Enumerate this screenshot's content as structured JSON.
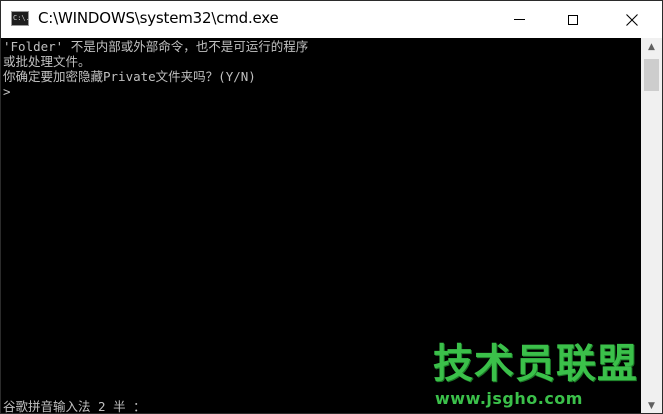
{
  "window": {
    "title": "C:\\WINDOWS\\system32\\cmd.exe",
    "icon": "cmd-console-icon",
    "icon_text": "C:\\."
  },
  "caption_buttons": {
    "minimize_icon": "minimize-icon",
    "maximize_icon": "maximize-icon",
    "close_icon": "close-icon"
  },
  "console": {
    "lines": [
      "'Folder' 不是内部或外部命令，也不是可运行的程序",
      "或批处理文件。",
      "你确定要加密隐藏Private文件夹吗？(Y/N)",
      ">"
    ],
    "ime_status": "谷歌拼音输入法 2 半 ："
  },
  "scrollbar": {
    "up_arrow": "▲",
    "down_arrow": "▼"
  },
  "watermark": {
    "logo_text": "技术员联盟",
    "url": "www.jsgho.com"
  },
  "colors": {
    "console_bg": "#000000",
    "console_text": "#c0c0c0",
    "watermark_green": "#3bc04a"
  }
}
